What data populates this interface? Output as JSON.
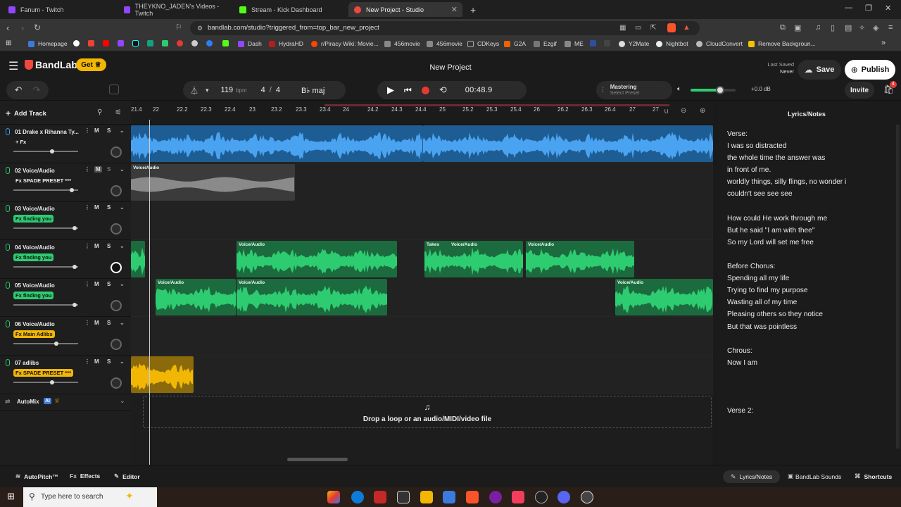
{
  "browser": {
    "tabs": [
      {
        "label": "Fanum - Twitch",
        "color": "#9146ff"
      },
      {
        "label": "THEYKNO_JADEN's Videos - Twitch",
        "color": "#9146ff"
      },
      {
        "label": "Stream - Kick Dashboard",
        "color": "#53fc18"
      },
      {
        "label": "New Project - Studio",
        "color": "#f2473f"
      }
    ],
    "url": "bandlab.com/studio?triggered_from=top_bar_new_project",
    "bookmarks": [
      "Homepage",
      "Dash",
      "HydraHD",
      "r/Piracy Wiki: Movie...",
      "456movie",
      "456movie",
      "CDKeys",
      "G2A",
      "Ezgif",
      "ME",
      "Y2Mate",
      "Nightbot",
      "CloudConvert",
      "Remove Backgroun..."
    ]
  },
  "header": {
    "brand": "BandLab",
    "get_label": "Get",
    "project_title": "New Project",
    "last_saved_label": "Last Saved",
    "last_saved_value": "Never",
    "save_label": "Save",
    "publish_label": "Publish"
  },
  "toolbar": {
    "bpm": "119",
    "bpm_unit": "bpm",
    "time_sig_num": "4",
    "time_sig_den": "4",
    "key": "B♭ maj",
    "time": "00:48.9",
    "mastering_label": "Mastering",
    "mastering_preset": "Select Preset",
    "volume_db": "+0.0 dB",
    "invite_label": "Invite",
    "cart_badge": "4"
  },
  "ruler": [
    "21.4",
    "22",
    "22.2",
    "22.3",
    "22.4",
    "23",
    "23.2",
    "23.3",
    "23.4",
    "24",
    "24.2",
    "24.3",
    "24.4",
    "25",
    "25.2",
    "25.3",
    "25.4",
    "26",
    "26.2",
    "26.3",
    "26.4",
    "27",
    "27"
  ],
  "add_track_label": "Add Track",
  "tracks": [
    {
      "name": "01  Drake x Rihanna Ty...",
      "fx": "+ Fx",
      "fx_style": "plain",
      "volume": 0.6
    },
    {
      "name": "02  Voice/Audio",
      "fx": "Fx SPADE PRESET ***",
      "fx_style": "plain",
      "volume": 0.93
    },
    {
      "name": "03  Voice/Audio",
      "fx": "Fx finding you",
      "fx_style": "green",
      "volume": 0.98
    },
    {
      "name": "04  Voice/Audio",
      "fx": "Fx finding you",
      "fx_style": "green",
      "volume": 0.98
    },
    {
      "name": "05  Voice/Audio",
      "fx": "Fx finding you",
      "fx_style": "green",
      "volume": 0.98
    },
    {
      "name": "06  Voice/Audio",
      "fx": "Fx Main Adlibs",
      "fx_style": "orange",
      "volume": 0.68
    },
    {
      "name": "07  adlibs",
      "fx": "Fx SPADE PRESET ***",
      "fx_style": "orange",
      "volume": 0.6
    }
  ],
  "clip_label": "Voice/Audio",
  "takes_label": "Takes",
  "automix": {
    "label": "AutoMix",
    "badge": "AI"
  },
  "drop_text": "Drop a loop or an audio/MIDI/video file",
  "lyrics": {
    "title": "Lyrics/Notes",
    "lines": [
      "Verse:",
      "I was so distracted",
      "the whole time the answer was",
      "in front of me.",
      "worldly things, silly flings, no wonder i",
      "couldn't see see see",
      "",
      "How could He work through me",
      "But he said \"I am with thee\"",
      "So my Lord will set me free",
      "",
      "Before Chorus:",
      "Spending all my life",
      "Trying to find my purpose",
      "Wasting all of my time",
      "Pleasing others so they notice",
      "But that was pointless",
      "",
      "Chrous:",
      "Now I am",
      "",
      "",
      "",
      "Verse 2:"
    ]
  },
  "bottom": {
    "autopitch": "AutoPitch™",
    "effects": "Effects",
    "editor": "Editor",
    "lyrics_notes": "Lyrics/Notes",
    "sounds": "BandLab Sounds",
    "shortcuts": "Shortcuts"
  },
  "taskbar": {
    "search_placeholder": "Type here to search"
  },
  "colors": {
    "blue": "#3b93e0",
    "green": "#2ecc71",
    "orange": "#f2b705",
    "red": "#e53935",
    "accent": "#f2473f"
  }
}
